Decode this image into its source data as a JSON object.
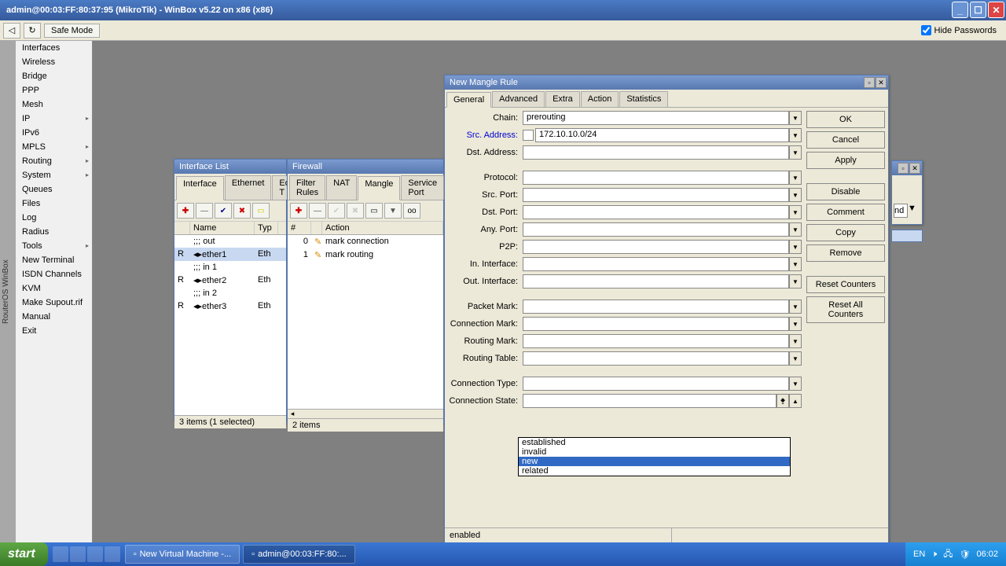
{
  "titlebar": {
    "title": "admin@00:03:FF:80:37:95 (MikroTik) - WinBox v5.22 on x86 (x86)"
  },
  "toolbar": {
    "back": "◁",
    "reload": "↻",
    "safe_mode": "Safe Mode",
    "hide_passwords": "Hide Passwords"
  },
  "vlabel": "RouterOS WinBox",
  "menu": [
    {
      "label": "Interfaces"
    },
    {
      "label": "Wireless"
    },
    {
      "label": "Bridge"
    },
    {
      "label": "PPP"
    },
    {
      "label": "Mesh"
    },
    {
      "label": "IP",
      "sub": true
    },
    {
      "label": "IPv6"
    },
    {
      "label": "MPLS",
      "sub": true
    },
    {
      "label": "Routing",
      "sub": true
    },
    {
      "label": "System",
      "sub": true
    },
    {
      "label": "Queues"
    },
    {
      "label": "Files"
    },
    {
      "label": "Log"
    },
    {
      "label": "Radius"
    },
    {
      "label": "Tools",
      "sub": true
    },
    {
      "label": "New Terminal"
    },
    {
      "label": "ISDN Channels"
    },
    {
      "label": "KVM"
    },
    {
      "label": "Make Supout.rif"
    },
    {
      "label": "Manual"
    },
    {
      "label": "Exit"
    }
  ],
  "win_interfaces": {
    "title": "Interface List",
    "tabs": [
      "Interface",
      "Ethernet",
      "EoIP T"
    ],
    "active_tab": 0,
    "cols": [
      "",
      "Name",
      "Typ"
    ],
    "rows": [
      {
        "flag": "",
        "name": ";;; out",
        "type": ""
      },
      {
        "flag": "R",
        "name": "◂▸ether1",
        "type": "Eth"
      },
      {
        "flag": "",
        "name": ";;; in 1",
        "type": ""
      },
      {
        "flag": "R",
        "name": "◂▸ether2",
        "type": "Eth"
      },
      {
        "flag": "",
        "name": ";;; in 2",
        "type": ""
      },
      {
        "flag": "R",
        "name": "◂▸ether3",
        "type": "Eth"
      }
    ],
    "status": "3 items (1 selected)"
  },
  "win_firewall": {
    "title": "Firewall",
    "tabs": [
      "Filter Rules",
      "NAT",
      "Mangle",
      "Service Port"
    ],
    "active_tab": 2,
    "cols": [
      "#",
      "",
      "Action"
    ],
    "rows": [
      {
        "n": "0",
        "action": "mark connection"
      },
      {
        "n": "1",
        "action": "mark routing"
      }
    ],
    "status": "2 items"
  },
  "dialog": {
    "title": "New Mangle Rule",
    "tabs": [
      "General",
      "Advanced",
      "Extra",
      "Action",
      "Statistics"
    ],
    "active_tab": 0,
    "fields": {
      "chain": {
        "label": "Chain:",
        "value": "prerouting"
      },
      "src_addr": {
        "label": "Src. Address:",
        "value": "172.10.10.0/24",
        "blue": true
      },
      "dst_addr": {
        "label": "Dst. Address:"
      },
      "protocol": {
        "label": "Protocol:"
      },
      "src_port": {
        "label": "Src. Port:"
      },
      "dst_port": {
        "label": "Dst. Port:"
      },
      "any_port": {
        "label": "Any. Port:"
      },
      "p2p": {
        "label": "P2P:"
      },
      "in_if": {
        "label": "In. Interface:"
      },
      "out_if": {
        "label": "Out. Interface:"
      },
      "pkt_mark": {
        "label": "Packet Mark:"
      },
      "conn_mark": {
        "label": "Connection Mark:"
      },
      "route_mark": {
        "label": "Routing Mark:"
      },
      "route_tbl": {
        "label": "Routing Table:"
      },
      "conn_type": {
        "label": "Connection Type:"
      },
      "conn_state": {
        "label": "Connection State:"
      }
    },
    "dropdown_options": [
      "established",
      "invalid",
      "new",
      "related"
    ],
    "dropdown_highlight": 2,
    "buttons": [
      "OK",
      "Cancel",
      "Apply",
      "Disable",
      "Comment",
      "Copy",
      "Remove",
      "Reset Counters",
      "Reset All Counters"
    ],
    "status": "enabled"
  },
  "bg_win": {
    "find": "nd"
  },
  "taskbar": {
    "start": "start",
    "tasks": [
      "New Virtual Machine -...",
      "admin@00:03:FF:80:..."
    ],
    "tray": {
      "lang": "EN",
      "time": "06:02"
    }
  }
}
